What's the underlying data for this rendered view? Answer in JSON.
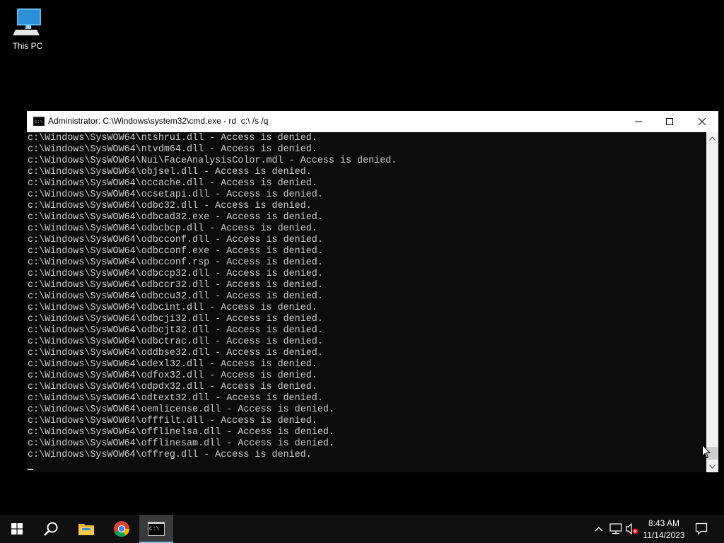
{
  "desktop": {
    "icons": [
      {
        "label": "This PC",
        "icon": "computer-icon"
      }
    ]
  },
  "window": {
    "title": "Administrator: C:\\Windows\\system32\\cmd.exe - rd  c:\\ /s /q",
    "controls": {
      "minimize": "minimize-icon",
      "maximize": "maximize-icon",
      "close": "close-icon"
    }
  },
  "console": {
    "lines": [
      "c:\\Windows\\SysWOW64\\ntshrui.dll - Access is denied.",
      "c:\\Windows\\SysWOW64\\ntvdm64.dll - Access is denied.",
      "c:\\Windows\\SysWOW64\\Nui\\FaceAnalysisColor.mdl - Access is denied.",
      "c:\\Windows\\SysWOW64\\objsel.dll - Access is denied.",
      "c:\\Windows\\SysWOW64\\occache.dll - Access is denied.",
      "c:\\Windows\\SysWOW64\\ocsetapi.dll - Access is denied.",
      "c:\\Windows\\SysWOW64\\odbc32.dll - Access is denied.",
      "c:\\Windows\\SysWOW64\\odbcad32.exe - Access is denied.",
      "c:\\Windows\\SysWOW64\\odbcbcp.dll - Access is denied.",
      "c:\\Windows\\SysWOW64\\odbcconf.dll - Access is denied.",
      "c:\\Windows\\SysWOW64\\odbcconf.exe - Access is denied.",
      "c:\\Windows\\SysWOW64\\odbcconf.rsp - Access is denied.",
      "c:\\Windows\\SysWOW64\\odbccp32.dll - Access is denied.",
      "c:\\Windows\\SysWOW64\\odbccr32.dll - Access is denied.",
      "c:\\Windows\\SysWOW64\\odbccu32.dll - Access is denied.",
      "c:\\Windows\\SysWOW64\\odbcint.dll - Access is denied.",
      "c:\\Windows\\SysWOW64\\odbcji32.dll - Access is denied.",
      "c:\\Windows\\SysWOW64\\odbcjt32.dll - Access is denied.",
      "c:\\Windows\\SysWOW64\\odbctrac.dll - Access is denied.",
      "c:\\Windows\\SysWOW64\\oddbse32.dll - Access is denied.",
      "c:\\Windows\\SysWOW64\\odexl32.dll - Access is denied.",
      "c:\\Windows\\SysWOW64\\odfox32.dll - Access is denied.",
      "c:\\Windows\\SysWOW64\\odpdx32.dll - Access is denied.",
      "c:\\Windows\\SysWOW64\\odtext32.dll - Access is denied.",
      "c:\\Windows\\SysWOW64\\oemlicense.dll - Access is denied.",
      "c:\\Windows\\SysWOW64\\offfilt.dll - Access is denied.",
      "c:\\Windows\\SysWOW64\\offlinelsa.dll - Access is denied.",
      "c:\\Windows\\SysWOW64\\offlinesam.dll - Access is denied.",
      "c:\\Windows\\SysWOW64\\offreg.dll - Access is denied."
    ],
    "colors": {
      "background": "#0c0c0c",
      "text": "#cccccc"
    }
  },
  "taskbar": {
    "apps": [
      {
        "name": "start",
        "icon": "windows-logo-icon"
      },
      {
        "name": "search",
        "icon": "search-icon"
      },
      {
        "name": "file-explorer",
        "icon": "folder-icon"
      },
      {
        "name": "chrome",
        "icon": "chrome-icon"
      },
      {
        "name": "cmd",
        "icon": "terminal-icon",
        "active": true
      }
    ],
    "tray": {
      "icons": [
        "chevron-up-icon",
        "network-icon",
        "volume-muted-icon",
        "notification-icon"
      ]
    },
    "clock": {
      "time": "8:43 AM",
      "date": "11/14/2023"
    },
    "accent": "#76b9ed"
  }
}
